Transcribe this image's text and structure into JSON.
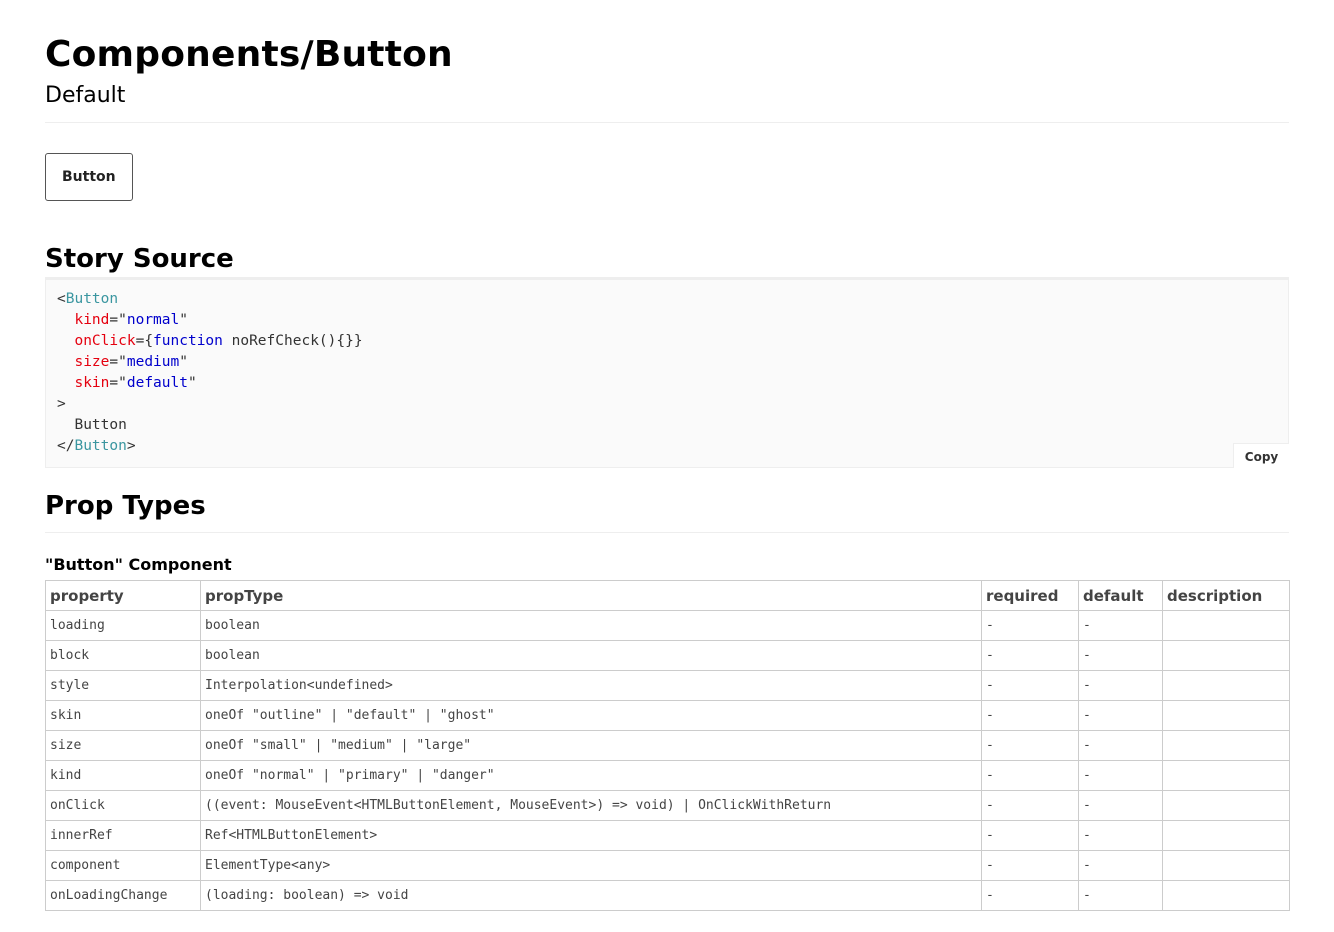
{
  "header": {
    "title": "Components/Button",
    "subtitle": "Default"
  },
  "preview": {
    "button_label": "Button"
  },
  "story_source": {
    "title": "Story Source",
    "copy_label": "Copy",
    "tokens": {
      "lt": "<",
      "gt": ">",
      "close_lt": "</",
      "tag_name": "Button",
      "eq": "=",
      "quote": "\"",
      "attr_kind": "kind",
      "val_kind": "normal",
      "attr_onclick": "onClick",
      "onclick_open": "{",
      "kw_function": "function",
      "onclick_body": " noRefCheck(){}}",
      "attr_size": "size",
      "val_size": "medium",
      "attr_skin": "skin",
      "val_skin": "default",
      "children": "Button"
    }
  },
  "prop_types": {
    "title": "Prop Types",
    "component_heading": "\"Button\" Component",
    "columns": [
      "property",
      "propType",
      "required",
      "default",
      "description"
    ],
    "rows": [
      [
        "loading",
        "boolean",
        "-",
        "-",
        ""
      ],
      [
        "block",
        "boolean",
        "-",
        "-",
        ""
      ],
      [
        "style",
        "Interpolation<undefined>",
        "-",
        "-",
        ""
      ],
      [
        "skin",
        "oneOf \"outline\" | \"default\" | \"ghost\"",
        "-",
        "-",
        ""
      ],
      [
        "size",
        "oneOf \"small\" | \"medium\" | \"large\"",
        "-",
        "-",
        ""
      ],
      [
        "kind",
        "oneOf \"normal\" | \"primary\" | \"danger\"",
        "-",
        "-",
        ""
      ],
      [
        "onClick",
        "((event: MouseEvent<HTMLButtonElement, MouseEvent>) => void) | OnClickWithReturn",
        "-",
        "-",
        ""
      ],
      [
        "innerRef",
        "Ref<HTMLButtonElement>",
        "-",
        "-",
        ""
      ],
      [
        "component",
        "ElementType<any>",
        "-",
        "-",
        ""
      ],
      [
        "onLoadingChange",
        "(loading: boolean) => void",
        "-",
        "-",
        ""
      ]
    ]
  },
  "colors": {
    "tag": "#3a96a0",
    "attribute": "#e5000f",
    "string": "#0000cc",
    "border": "#cccccc"
  }
}
